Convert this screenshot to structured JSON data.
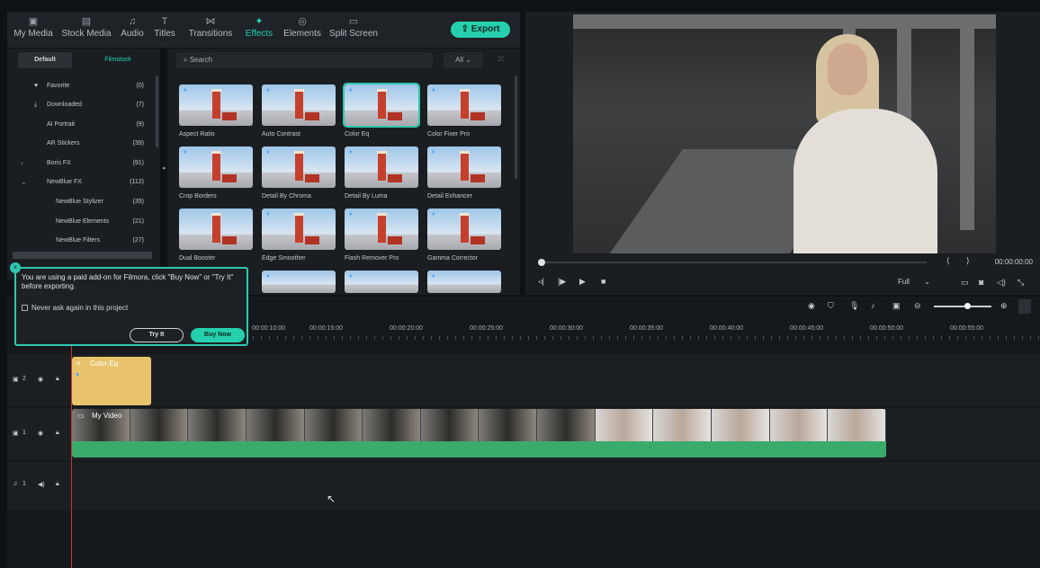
{
  "nav": {
    "tabs": [
      {
        "label": "My Media",
        "icon": "media-icon"
      },
      {
        "label": "Stock Media",
        "icon": "stock-icon"
      },
      {
        "label": "Audio",
        "icon": "audio-icon"
      },
      {
        "label": "Titles",
        "icon": "titles-icon"
      },
      {
        "label": "Transitions",
        "icon": "transitions-icon"
      },
      {
        "label": "Effects",
        "icon": "effects-icon",
        "active": true
      },
      {
        "label": "Elements",
        "icon": "elements-icon"
      },
      {
        "label": "Split Screen",
        "icon": "split-screen-icon"
      }
    ],
    "export_label": "Export"
  },
  "sidebar": {
    "segments": [
      "Default",
      "Filmstock"
    ],
    "items": [
      {
        "label": "Favorite",
        "count": "(0)"
      },
      {
        "label": "Downloaded",
        "count": "(7)"
      },
      {
        "label": "AI Portrait",
        "count": "(9)"
      },
      {
        "label": "AR Stickers",
        "count": "(39)"
      },
      {
        "label": "Boris FX",
        "count": "(91)"
      },
      {
        "label": "NewBlue FX",
        "count": "(112)"
      },
      {
        "label": "NewBlue Stylizer",
        "count": "(35)"
      },
      {
        "label": "NewBlue Elements",
        "count": "(21)"
      },
      {
        "label": "NewBlue Filters",
        "count": "(27)"
      }
    ]
  },
  "content": {
    "search_placeholder": "Search",
    "filter_value": "All",
    "effects": [
      "Aspect Ratio",
      "Auto Contrast",
      "Color Eq",
      "Color Fixer Pro",
      "Crop Borders",
      "Detail By Chroma",
      "Detail By Luma",
      "Detail Enhancer",
      "Dual Booster",
      "Edge Smoother",
      "Flash Remover Pro",
      "Gamma Corrector"
    ]
  },
  "preview": {
    "timecode": "00:00:00:00",
    "quality": "Full"
  },
  "timeline": {
    "ticks": [
      "00:00:10:00",
      "00:00:15:00",
      "00:00:20:00",
      "00:00:25:00",
      "00:00:30:00",
      "00:00:35:00",
      "00:00:40:00",
      "00:00:45:00",
      "00:00:50:00",
      "00:00:55:00"
    ],
    "tracks": [
      {
        "label": "2",
        "type": "fx"
      },
      {
        "label": "1",
        "type": "video"
      },
      {
        "label": "1",
        "type": "audio"
      }
    ],
    "clip_fx_label": "Color Eq",
    "clip_video_label": "My Video"
  },
  "popup": {
    "message": "You are using a paid add-on for Filmora, click \"Buy Now\" or \"Try It\" before exporting.",
    "checkbox_label": "Never ask again in this project",
    "try_label": "Try It",
    "buy_label": "Buy Now"
  }
}
